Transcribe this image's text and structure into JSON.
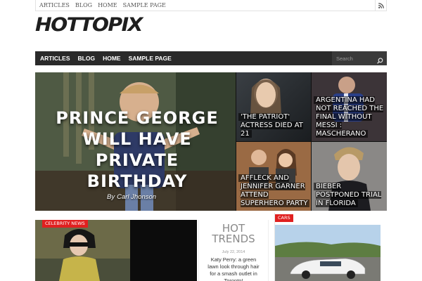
{
  "topbar": {
    "links": [
      "ARTICLES",
      "BLOG",
      "HOME",
      "SAMPLE PAGE"
    ],
    "rss_icon": "rss-icon"
  },
  "logo": "HOTTOPIX",
  "nav": {
    "items": [
      "ARTICLES",
      "BLOG",
      "HOME",
      "SAMPLE PAGE"
    ],
    "search_placeholder": "Search",
    "search_icon": "search-icon"
  },
  "featured": {
    "main": {
      "title": "PRINCE GEORGE WILL HAVE PRIVATE BIRTHDAY",
      "by": "By",
      "author": "Carl Jhonson"
    },
    "tiles": [
      {
        "title": "'THE PATRIOT' ACTRESS DIED AT 21"
      },
      {
        "title": "ARGENTINA HAD NOT REACHED THE FINAL WITHOUT MESSI : MASCHERANO"
      },
      {
        "title": "AFFLECK AND JENNIFER GARNER ATTEND SUPERHERO PARTY"
      },
      {
        "title": "BIEBER POSTPONED TRIAL IN FLORIDA"
      }
    ]
  },
  "sections": {
    "celebrity": {
      "label": "CELEBRITY NEWS"
    },
    "hot_trends": {
      "title": "HOT TRENDS",
      "date": "July 22, 2014",
      "snippet": "Katy Perry: a green lawn look through hair for a smash outlet in Toronto!"
    },
    "cars": {
      "label": "CARS"
    }
  },
  "colors": {
    "accent": "#e02020",
    "nav_bg": "#2a2a2a"
  }
}
